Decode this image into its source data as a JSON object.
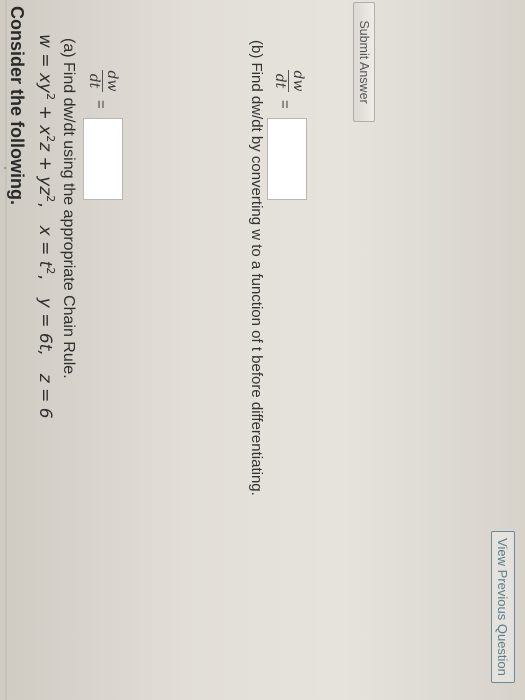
{
  "question": {
    "heading": "Consider the following.",
    "equation": {
      "w_lhs": "w",
      "equals": " = ",
      "t1_base_a": "xy",
      "t1_exp": "2",
      "plus1": " + ",
      "t2_base": "x",
      "t2_exp": "2",
      "t2_tail": "z",
      "plus2": " + ",
      "t3_base": "yz",
      "t3_exp": "2",
      "sep1": ",",
      "x_def": "x = t",
      "x_exp": "2",
      "sep2": ",",
      "y_def": "y = 6t,",
      "z_def": "z = 6"
    },
    "part_a": {
      "label": "(a) Find dw/dt using the appropriate Chain Rule.",
      "frac_num": "dw",
      "frac_den": "dt",
      "equals": "=",
      "answer_value": ""
    },
    "part_b": {
      "label": "(b) Find dw/dt by converting w to a function of t before differentiating.",
      "frac_num": "dw",
      "frac_den": "dt",
      "equals": "=",
      "answer_value": ""
    }
  },
  "buttons": {
    "submit_label": "Submit Answer",
    "view_previous_label": "View Previous Question"
  },
  "colors": {
    "view_previous_border": "#6b8b9a",
    "view_previous_text": "#5d7c8b",
    "answer_box_border": "#b9b6b1"
  }
}
